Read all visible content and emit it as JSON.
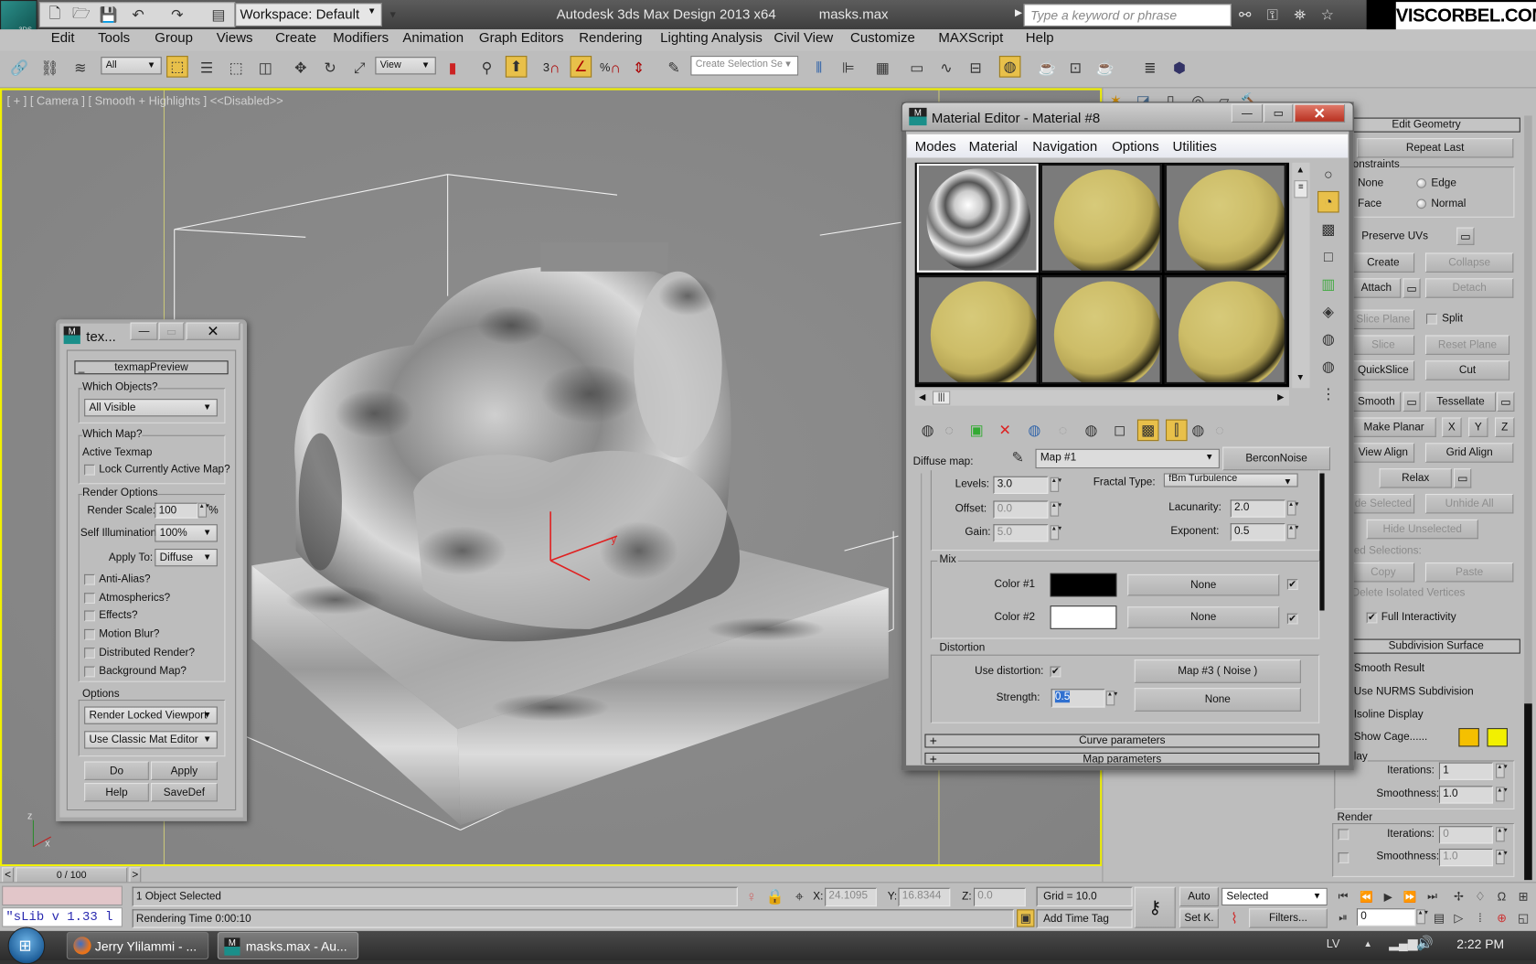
{
  "app": {
    "title": "Autodesk 3ds Max Design 2013 x64",
    "file": "masks.max",
    "logo_text": "3DS",
    "workspace": "Workspace: Default",
    "search_placeholder": "Type a keyword or phrase",
    "watermark": "VISCORBEL.COM"
  },
  "menu": [
    "Edit",
    "Tools",
    "Group",
    "Views",
    "Create",
    "Modifiers",
    "Animation",
    "Graph Editors",
    "Rendering",
    "Lighting Analysis",
    "Civil View",
    "Customize",
    "MAXScript",
    "Help"
  ],
  "toolbar": {
    "selection_filter": "All",
    "reference_coord": "View",
    "named_selection_placeholder": "Create Selection Se",
    "snap_label": "3",
    "percent_label": "%"
  },
  "viewport": {
    "label": "[ + ] [ Camera ] [ Smooth + Highlights ] <<Disabled>>",
    "border_color": "#f0f000",
    "gizmo_x": "x",
    "gizmo_y": "y",
    "axis_z": "z",
    "axis_x": "x"
  },
  "texmap_window": {
    "title": "tex...",
    "rollout": "texmapPreview",
    "which_objects": {
      "title": "Which Objects?",
      "value": "All Visible"
    },
    "which_map": {
      "title": "Which Map?",
      "active": "Active Texmap",
      "lock_label": "Lock Currently Active Map?",
      "lock_checked": false
    },
    "render_options": {
      "title": "Render Options",
      "render_scale_label": "Render Scale:",
      "render_scale": "100",
      "percent": "%",
      "self_illum_label": "Self Illumination:",
      "self_illum": "100%",
      "apply_to_label": "Apply To:",
      "apply_to": "Diffuse",
      "checkboxes": [
        {
          "label": "Anti-Alias?",
          "checked": false
        },
        {
          "label": "Atmospherics?",
          "checked": false
        },
        {
          "label": "Effects?",
          "checked": false
        },
        {
          "label": "Motion Blur?",
          "checked": false
        },
        {
          "label": "Distributed Render?",
          "checked": false
        },
        {
          "label": "Background Map?",
          "checked": false
        }
      ]
    },
    "options": {
      "title": "Options",
      "viewport": "Render Locked Viewport",
      "editor": "Use Classic Mat Editor"
    },
    "buttons": {
      "do": "Do",
      "apply": "Apply",
      "help": "Help",
      "savedef": "SaveDef"
    }
  },
  "material_editor": {
    "title": "Material Editor - Material #8",
    "menu": [
      "Modes",
      "Material",
      "Navigation",
      "Options",
      "Utilities"
    ],
    "diffuse_label": "Diffuse map:",
    "map_name": "Map #1",
    "map_type": "BerconNoise",
    "params": {
      "levels_label": "Levels:",
      "levels": "3.0",
      "offset_label": "Offset:",
      "offset": "0.0",
      "gain_label": "Gain:",
      "gain": "5.0",
      "fractal_label": "Fractal Type:",
      "fractal": "fBm Turbulence",
      "lacunarity_label": "Lacunarity:",
      "lacunarity": "2.0",
      "exponent_label": "Exponent:",
      "exponent": "0.5"
    },
    "mix": {
      "title": "Mix",
      "color1_label": "Color #1",
      "color1": "#000000",
      "color1_map": "None",
      "color1_on": true,
      "color2_label": "Color #2",
      "color2": "#ffffff",
      "color2_map": "None",
      "color2_on": true
    },
    "distortion": {
      "title": "Distortion",
      "use_label": "Use distortion:",
      "use": true,
      "map": "Map #3  ( Noise )",
      "strength_label": "Strength:",
      "strength": "0.5",
      "strength_map": "None"
    },
    "rollouts": [
      "Curve parameters",
      "Map parameters"
    ],
    "rollout_sign": "+"
  },
  "command_panel": {
    "edit_geometry": "Edit Geometry",
    "repeat_last": "Repeat Last",
    "constraints_title": "onstraints",
    "constraints": [
      "None",
      "Edge",
      "Face",
      "Normal"
    ],
    "preserve_uvs": "Preserve UVs",
    "create": "Create",
    "collapse": "Collapse",
    "attach": "Attach",
    "detach": "Detach",
    "slice_plane": "Slice Plane",
    "split": "Split",
    "slice": "Slice",
    "reset_plane": "Reset Plane",
    "quickslice": "QuickSlice",
    "cut": "Cut",
    "smooth": "Smooth",
    "tessellate": "Tessellate",
    "make_planar": "Make Planar",
    "x": "X",
    "y": "Y",
    "z": "Z",
    "view_align": "View Align",
    "grid_align": "Grid Align",
    "relax": "Relax",
    "hide_selected": "de Selected",
    "unhide_all": "Unhide All",
    "hide_unselected": "Hide Unselected",
    "named_selections": "ed Selections:",
    "copy": "Copy",
    "paste": "Paste",
    "delete_isolated": "Delete Isolated Vertices",
    "full_interactivity": "Full Interactivity",
    "full_interactivity_on": true,
    "subdivision": "Subdivision Surface",
    "smooth_result": "Smooth Result",
    "use_nurms": "Use NURMS Subdivision",
    "isoline": "Isoline Display",
    "show_cage": "Show Cage......",
    "cage_colors": [
      "#f5c000",
      "#f2f000"
    ],
    "display_title": "lay",
    "iterations_label": "Iterations:",
    "display_iterations": "1",
    "smoothness_label": "Smoothness:",
    "display_smoothness": "1.0",
    "render_title": "Render",
    "render_iterations": "0",
    "render_smoothness": "1.0"
  },
  "timeline": {
    "frame": "0 / 100",
    "prev": "<",
    "next": ">"
  },
  "status": {
    "listener": "\"sLib v 1.33 l",
    "selected": "1 Object Selected",
    "render_time": "Rendering Time  0:00:10",
    "x_label": "X:",
    "x": "24.1095",
    "y_label": "Y:",
    "y": "16.8344",
    "z_label": "Z:",
    "z": "0.0",
    "grid": "Grid = 10.0",
    "add_time_tag": "Add Time Tag",
    "auto": "Auto",
    "set_key": "Set K.",
    "key_filter": "Selected",
    "filters": "Filters...",
    "current_frame": "0"
  },
  "taskbar": {
    "items": [
      "Jerry Ylilammi - ...",
      "masks.max - Au..."
    ],
    "lang": "LV",
    "time": "2:22 PM"
  }
}
